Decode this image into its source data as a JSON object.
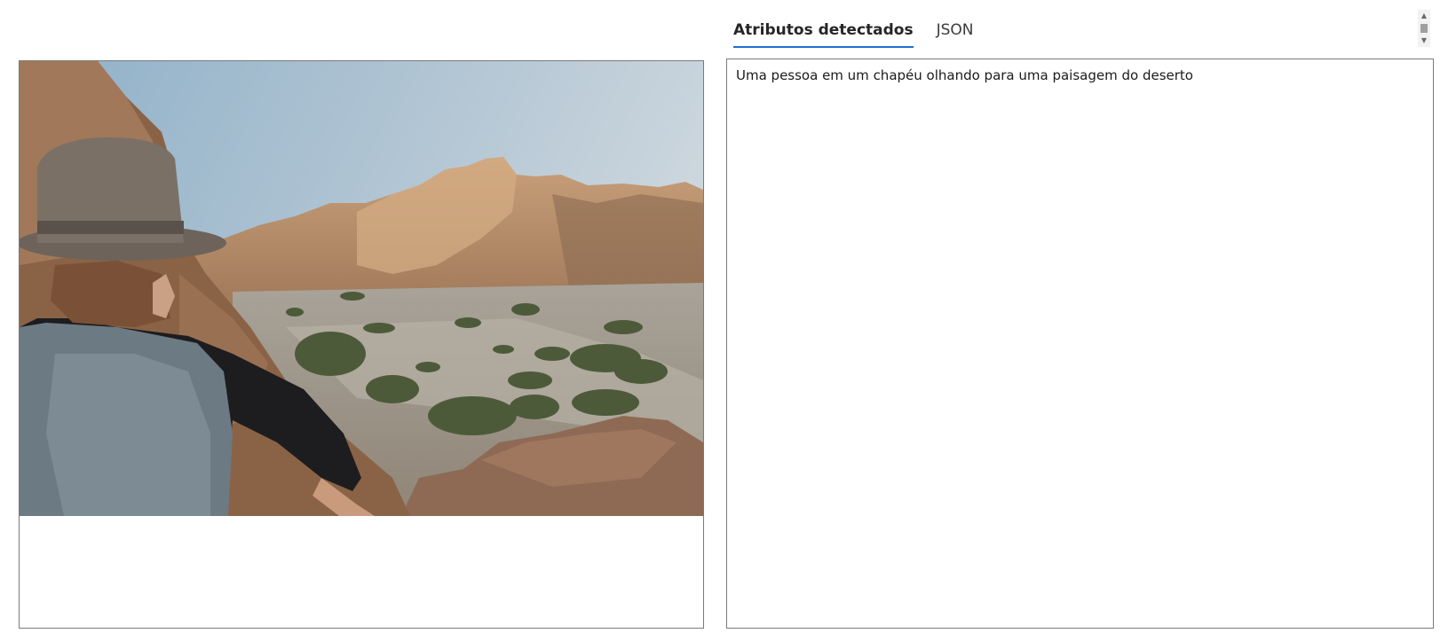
{
  "tabs": [
    {
      "label": "Atributos detectados",
      "active": true
    },
    {
      "label": "JSON",
      "active": false
    }
  ],
  "result": {
    "caption": "Uma pessoa em um chapéu olhando para uma paisagem do deserto"
  },
  "image": {
    "subject": "person-in-hat-overlooking-desert-landscape"
  },
  "colors": {
    "tab_accent": "#1f6fd1",
    "border": "#7a7a7a"
  }
}
